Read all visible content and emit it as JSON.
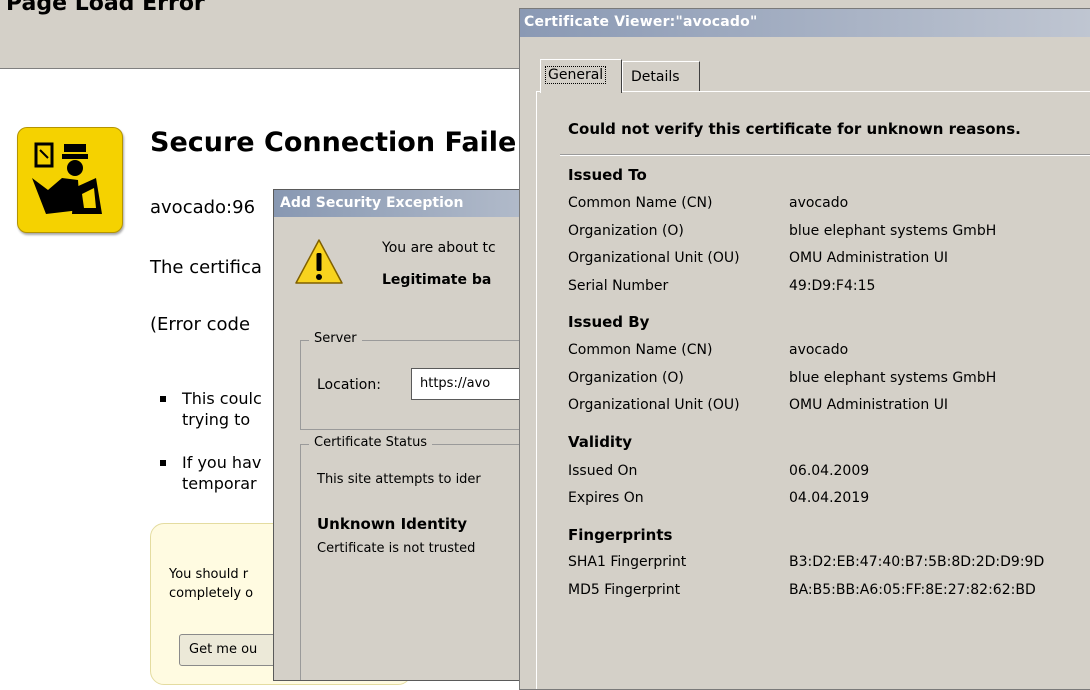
{
  "browser": {
    "title_partial": "Page Load Error",
    "error_title": "Secure Connection Faile",
    "host_line": "avocado:96",
    "cert_line": "The certifica",
    "code_line": "(Error code",
    "bullets": [
      {
        "line1": "This coulc",
        "line2": "trying to"
      },
      {
        "line1": "If you hav",
        "line2": "temporar"
      }
    ],
    "advice_line1": "You should r",
    "advice_line2": "completely o",
    "get_me_out": "Get me ou"
  },
  "add_exception": {
    "title": "Add Security Exception",
    "intro": "You are about tc",
    "legit": "Legitimate ba",
    "server_group": "Server",
    "location_label": "Location:",
    "location_value": "https://avo",
    "status_group": "Certificate Status",
    "attempts": "This site attempts to ider",
    "unknown_identity": "Unknown Identity",
    "not_trusted": "Certificate is not trusted"
  },
  "cert_viewer": {
    "title": "Certificate Viewer:\"avocado\"",
    "tabs": [
      {
        "label": "General",
        "selected": true
      },
      {
        "label": "Details",
        "selected": false
      }
    ],
    "status": "Could not verify this certificate for unknown reasons.",
    "issued_to": {
      "heading": "Issued To",
      "rows": [
        {
          "label": "Common Name (CN)",
          "value": "avocado"
        },
        {
          "label": "Organization (O)",
          "value": "blue elephant systems GmbH"
        },
        {
          "label": "Organizational Unit (OU)",
          "value": "OMU Administration UI"
        },
        {
          "label": "Serial Number",
          "value": "49:D9:F4:15"
        }
      ]
    },
    "issued_by": {
      "heading": "Issued By",
      "rows": [
        {
          "label": "Common Name (CN)",
          "value": "avocado"
        },
        {
          "label": "Organization (O)",
          "value": "blue elephant systems GmbH"
        },
        {
          "label": "Organizational Unit (OU)",
          "value": "OMU Administration UI"
        }
      ]
    },
    "validity": {
      "heading": "Validity",
      "rows": [
        {
          "label": "Issued On",
          "value": "06.04.2009"
        },
        {
          "label": "Expires On",
          "value": "04.04.2019"
        }
      ]
    },
    "fingerprints": {
      "heading": "Fingerprints",
      "rows": [
        {
          "label": "SHA1 Fingerprint",
          "value": "B3:D2:EB:47:40:B7:5B:8D:2D:D9:9D"
        },
        {
          "label": "MD5 Fingerprint",
          "value": "BA:B5:BB:A6:05:FF:8E:27:82:62:BD"
        }
      ]
    }
  },
  "colors": {
    "dialog_face": "#d4d0c8",
    "titlebar_inactive": "#8a99b4",
    "warning_yellow": "#f5d200",
    "advice_bg": "#fffbe1"
  }
}
